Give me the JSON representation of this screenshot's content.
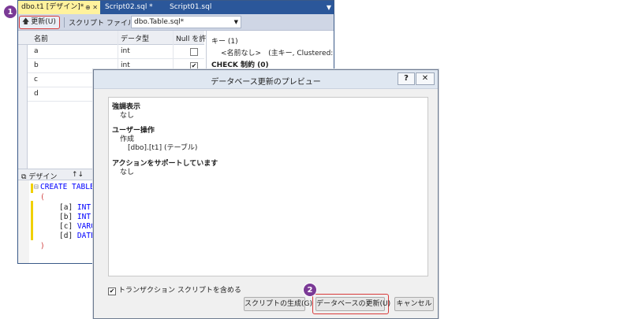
{
  "vs": {
    "tabs": [
      {
        "label": "dbo.t1 [デザイン]*",
        "glyphs": "⊕ ✕"
      },
      {
        "label": "Script02.sql *"
      },
      {
        "label": "Script01.sql"
      }
    ],
    "toolbar": {
      "update_label": "更新(U)",
      "script_file_label": "スクリプト ファイル(I):",
      "script_file_value": "dbo.Table.sql*"
    },
    "grid": {
      "headers": [
        "名前",
        "データ型",
        "Null を許"
      ],
      "rows": [
        {
          "name": "a",
          "type": "int",
          "nullable": false
        },
        {
          "name": "b",
          "type": "int",
          "nullable": true
        },
        {
          "name": "c",
          "type": "",
          "nullable": false
        },
        {
          "name": "d",
          "type": "",
          "nullable": false
        }
      ]
    },
    "properties": {
      "keys": "キー (1)",
      "key_item": "<名前なし>　(主キー, Clustered: a)",
      "check": "CHECK 制約 (0)"
    },
    "bottom_tabs": {
      "design": "デザイン",
      "swap": "↑↓"
    },
    "sql": {
      "line1": "CREATE TABLE",
      "line2": "(",
      "line3a": "[a] ",
      "line3b": "INT",
      "line4a": "[b] ",
      "line4b": "INT",
      "line5a": "[c] ",
      "line5b": "VARC",
      "line6a": "[d] ",
      "line6b": "DATE",
      "line7": ")"
    }
  },
  "callouts": {
    "one": "1",
    "two": "2"
  },
  "dialog": {
    "title": "データベース更新のプレビュー",
    "help": "?",
    "close": "✕",
    "sections": {
      "highlight_head": "強調表示",
      "highlight_value": "なし",
      "user_ops_head": "ユーザー操作",
      "user_ops_action": "作成",
      "user_ops_target": "[dbo].[t1] (テーブル)",
      "supporting_head": "アクションをサポートしています",
      "supporting_value": "なし"
    },
    "transaction_label": "トランザクション スクリプトを含める",
    "transaction_checked": true,
    "buttons": {
      "generate": "スクリプトの生成(G)",
      "update": "データベースの更新(U)",
      "cancel": "キャンセル"
    }
  },
  "colors": {
    "tab_active": "#fff29d",
    "tabstrip": "#2b579a",
    "callout": "#7b3a96",
    "highlight_frame": "#d83a3a",
    "sql_keyword": "#0000ff"
  }
}
